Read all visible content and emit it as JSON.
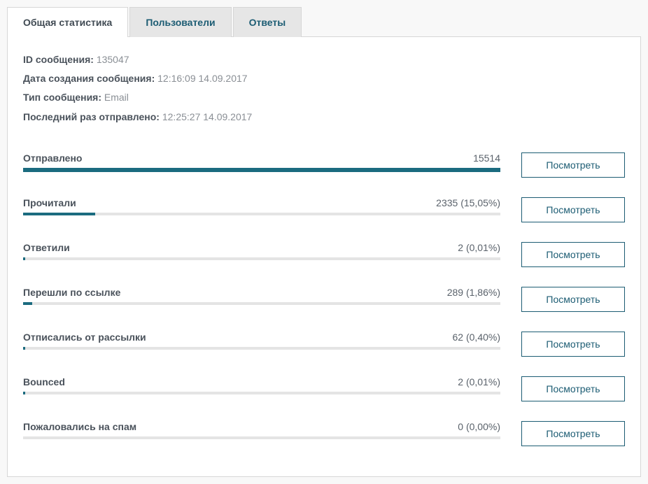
{
  "tabs": [
    {
      "label": "Общая статистика",
      "active": true
    },
    {
      "label": "Пользователи",
      "active": false
    },
    {
      "label": "Ответы",
      "active": false
    }
  ],
  "meta": {
    "message_id_label": "ID сообщения:",
    "message_id": "135047",
    "created_label": "Дата создания сообщения:",
    "created": "12:16:09 14.09.2017",
    "type_label": "Тип сообщения:",
    "type": "Email",
    "last_sent_label": "Последний раз отправлено:",
    "last_sent": "12:25:27 14.09.2017"
  },
  "view_label": "Посмотреть",
  "stats": [
    {
      "label": "Отправлено",
      "value": "15514",
      "percent": 100
    },
    {
      "label": "Прочитали",
      "value": "2335 (15,05%)",
      "percent": 15.05
    },
    {
      "label": "Ответили",
      "value": "2 (0,01%)",
      "percent": 0.5
    },
    {
      "label": "Перешли по ссылке",
      "value": "289 (1,86%)",
      "percent": 1.86
    },
    {
      "label": "Отписались от рассылки",
      "value": "62 (0,40%)",
      "percent": 0.5
    },
    {
      "label": "Bounced",
      "value": "2 (0,01%)",
      "percent": 0.5
    },
    {
      "label": "Пожаловались на спам",
      "value": "0 (0,00%)",
      "percent": 0
    }
  ]
}
